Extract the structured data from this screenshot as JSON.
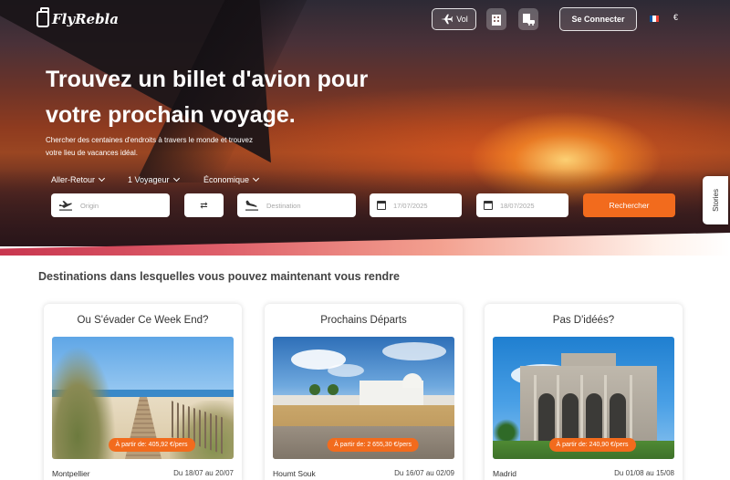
{
  "brand": {
    "name": "FlyRebla"
  },
  "nav": {
    "vol_label": "Vol",
    "login_label": "Se Connecter",
    "currency": "€",
    "flag_colors": [
      "#0055A4",
      "#FFFFFF",
      "#EF4135"
    ]
  },
  "hero": {
    "title": "Trouvez un billet d'avion pour votre prochain voyage.",
    "subtitle": "Chercher des centaines d'endroits à travers le monde et trouvez votre lieu de vacances idéal."
  },
  "search": {
    "trip_type": "Aller-Retour",
    "travelers": "1 Voyageur",
    "cabin_class": "Économique",
    "origin_placeholder": "Origin",
    "destination_placeholder": "Destination",
    "depart_date": "17/07/2025",
    "return_date": "18/07/2025",
    "search_label": "Rechercher",
    "accent_color": "#F26B1D"
  },
  "stories_label": "Stories",
  "section": {
    "title": "Destinations dans lesquelles vous pouvez maintenant vous rendre",
    "cards": [
      {
        "title": "Ou S'évader Ce Week End?",
        "price": "À partir de: 405,92 €/pers",
        "city": "Montpellier",
        "dates": "Du 18/07 au 20/07"
      },
      {
        "title": "Prochains Départs",
        "price": "À partir de: 2 655,30 €/pers",
        "city": "Houmt Souk",
        "dates": "Du 16/07 au 02/09"
      },
      {
        "title": "Pas D'idéés?",
        "price": "À partir de: 240,90 €/pers",
        "city": "Madrid",
        "dates": "Du 01/08 au 15/08"
      }
    ]
  }
}
